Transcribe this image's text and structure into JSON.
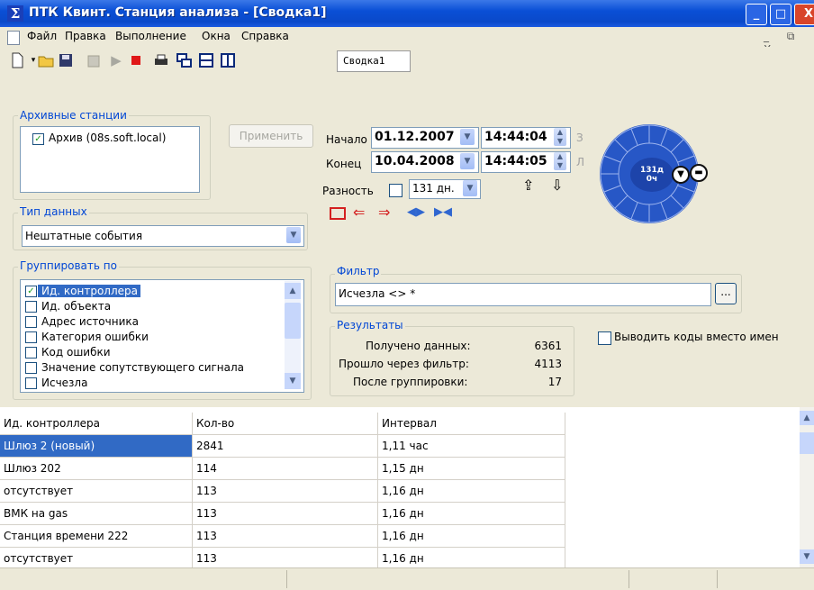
{
  "window": {
    "title": "ПТК Квинт. Станция анализа - [Сводка1]",
    "icon_glyph": "Σ",
    "min_glyph": "_",
    "max_glyph": "□",
    "close_glyph": "X"
  },
  "menu": {
    "items": [
      "Файл",
      "Правка",
      "Выполнение",
      "Окна",
      "Справка"
    ],
    "mdi_controls": "_ ⧉ X"
  },
  "toolbar": {
    "doc_tab": "Сводка1"
  },
  "archive": {
    "label": "Архивные станции",
    "stations": [
      {
        "name": "Архив (08s.soft.local)",
        "checked": true
      }
    ],
    "apply_label": "Применить"
  },
  "time": {
    "start_label": "Начало",
    "start_date": "01.12.2007",
    "start_time": "14:44:04",
    "end_label": "Конец",
    "end_date": "10.04.2008",
    "end_time": "14:44:05",
    "diff_label": "Разность",
    "diff_value": "131 дн.",
    "start_suffix": "З",
    "end_suffix": "Л"
  },
  "dial": {
    "days": "131д",
    "hours": "0ч"
  },
  "data_type": {
    "label": "Тип данных",
    "value": "Нештатные события"
  },
  "group_by": {
    "label": "Группировать по",
    "items": [
      {
        "name": "Ид. контроллера",
        "checked": true,
        "selected": true
      },
      {
        "name": "Ид. объекта",
        "checked": false
      },
      {
        "name": "Адрес источника",
        "checked": false
      },
      {
        "name": "Категория ошибки",
        "checked": false
      },
      {
        "name": "Код ошибки",
        "checked": false
      },
      {
        "name": "Значение сопутствующего сигнала",
        "checked": false
      },
      {
        "name": "Исчезла",
        "checked": false
      }
    ]
  },
  "filter": {
    "label": "Фильтр",
    "value": "Исчезла <> *",
    "browse_label": "..."
  },
  "results": {
    "label": "Результаты",
    "rows": [
      {
        "label": "Получено данных:",
        "value": "6361"
      },
      {
        "label": "Прошло через фильтр:",
        "value": "4113"
      },
      {
        "label": "После группировки:",
        "value": "17"
      }
    ]
  },
  "codes_option": {
    "label": "Выводить коды вместо имен",
    "checked": false
  },
  "table": {
    "headers": [
      "Ид. контроллера",
      "Кол-во",
      "Интервал"
    ],
    "rows": [
      [
        "Шлюз 2 (новый)",
        "2841",
        "1,11 час"
      ],
      [
        "Шлюз 202",
        "114",
        "1,15 дн"
      ],
      [
        "отсутствует",
        "113",
        "1,16 дн"
      ],
      [
        "ВМК на gas",
        "113",
        "1,16 дн"
      ],
      [
        "Станция времени 222",
        "113",
        "1,16 дн"
      ],
      [
        "отсутствует",
        "113",
        "1,16 дн"
      ]
    ],
    "selected_row": 0
  },
  "colors": {
    "title_blue": "#0a4fd6",
    "panel_bg": "#ece9d8",
    "group_label": "#0046d5",
    "selection": "#316ac5",
    "dial_blue": "#2757c6",
    "nav_red": "#d42020"
  },
  "icons": [
    "new-file-icon",
    "open-folder-icon",
    "save-icon",
    "properties-icon",
    "play-icon",
    "stop-icon",
    "print-icon",
    "cascade-icon",
    "tile-horizontal-icon",
    "tile-vertical-icon"
  ]
}
